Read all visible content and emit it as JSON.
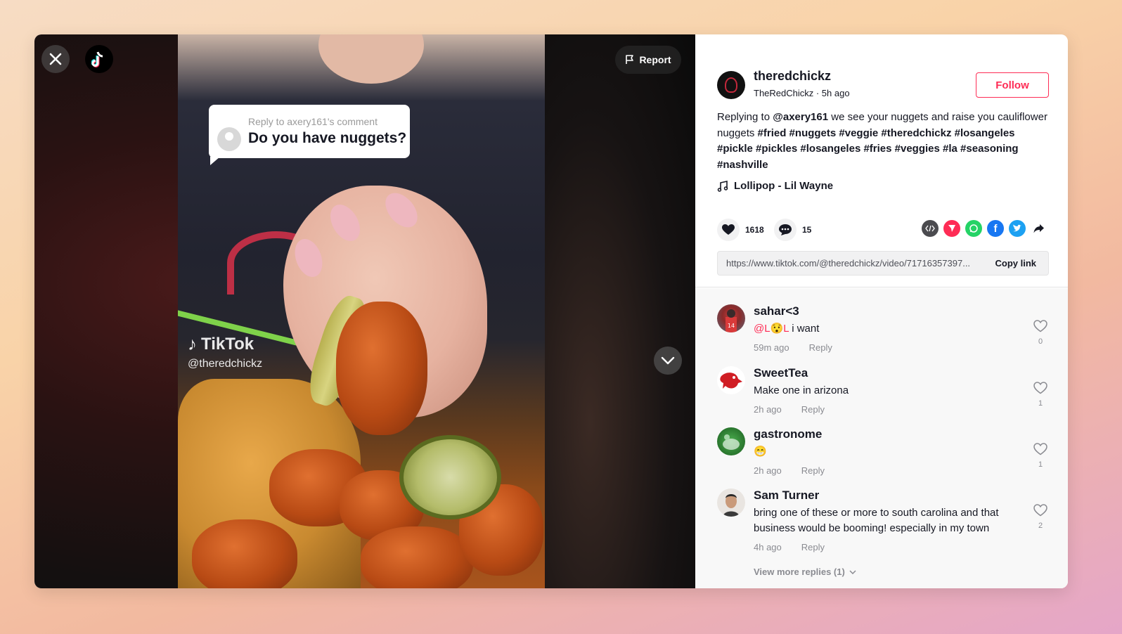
{
  "video": {
    "reply_label": "Reply to axery161's comment",
    "reply_text": "Do you have nuggets?",
    "watermark_brand": "TikTok",
    "watermark_handle": "@theredchickz",
    "report_label": "Report",
    "icons": {
      "close": "close-icon",
      "logo": "tiktok-logo-icon",
      "report": "flag-icon",
      "next": "chevron-down-icon"
    }
  },
  "author": {
    "username": "theredchickz",
    "subtitle": "TheRedChickz · 5h ago",
    "follow_label": "Follow"
  },
  "caption": {
    "prefix": "Replying to ",
    "mention": "@axery161",
    "body": " we see your nuggets and raise you cauliflower nuggets ",
    "hashtags": "#fried #nuggets #veggie #theredchickz #losangeles #pickle #pickles #losangeles #fries #veggies #la #seasoning #nashville"
  },
  "music": {
    "title": "Lollipop - Lil Wayne",
    "icon": "music-note-icon"
  },
  "stats": {
    "likes": "1618",
    "comments": "15"
  },
  "share": {
    "icons": [
      "embed-icon",
      "send-icon",
      "whatsapp-icon",
      "facebook-icon",
      "twitter-icon",
      "share-arrow-icon"
    ],
    "colors": {
      "embed": "#4b4b4f",
      "send": "#fe2c55",
      "whatsapp": "#25d366",
      "facebook": "#1877f2",
      "twitter": "#1da1f2"
    }
  },
  "link": {
    "url": "https://www.tiktok.com/@theredchickz/video/71716357397...",
    "copy_label": "Copy link"
  },
  "comments": [
    {
      "name": "sahar<3",
      "mention": "@L😯L",
      "text": " i want",
      "time": "59m ago",
      "reply": "Reply",
      "likes": "0"
    },
    {
      "name": "SweetTea",
      "mention": "",
      "text": "Make one in arizona",
      "time": "2h ago",
      "reply": "Reply",
      "likes": "1"
    },
    {
      "name": "gastronome",
      "mention": "",
      "text": "😁",
      "time": "2h ago",
      "reply": "Reply",
      "likes": "1"
    },
    {
      "name": "Sam Turner",
      "mention": "",
      "text": "bring one of these or more to south carolina and that business would be booming! especially in my town",
      "time": "4h ago",
      "reply": "Reply",
      "likes": "2"
    }
  ],
  "view_more": "View more replies (1)",
  "accent_color": "#fe2c55"
}
